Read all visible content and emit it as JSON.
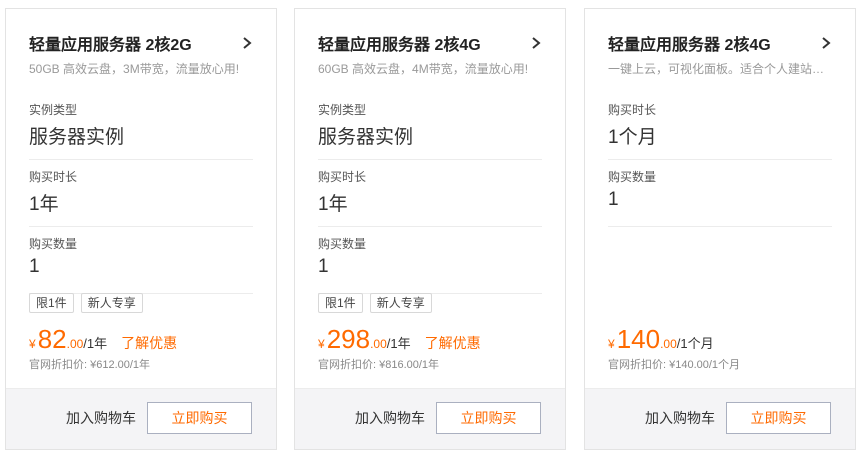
{
  "cards": [
    {
      "title": "轻量应用服务器 2核2G",
      "desc": "50GB 高效云盘，3M带宽，流量放心用!",
      "specs": [
        {
          "label": "实例类型",
          "value": "服务器实例"
        },
        {
          "label": "购买时长",
          "value": "1年"
        },
        {
          "label": "购买数量",
          "value": "1"
        }
      ],
      "tags": [
        "限1件",
        "新人专享"
      ],
      "price": {
        "currency": "¥",
        "integer": "82",
        "decimal": ".00",
        "unit": "/1年",
        "promo": "了解优惠"
      },
      "ref_price": "官网折扣价: ¥612.00/1年",
      "cart_label": "加入购物车",
      "buy_label": "立即购买"
    },
    {
      "title": "轻量应用服务器 2核4G",
      "desc": "60GB 高效云盘，4M带宽，流量放心用!",
      "specs": [
        {
          "label": "实例类型",
          "value": "服务器实例"
        },
        {
          "label": "购买时长",
          "value": "1年"
        },
        {
          "label": "购买数量",
          "value": "1"
        }
      ],
      "tags": [
        "限1件",
        "新人专享"
      ],
      "price": {
        "currency": "¥",
        "integer": "298",
        "decimal": ".00",
        "unit": "/1年",
        "promo": "了解优惠"
      },
      "ref_price": "官网折扣价: ¥816.00/1年",
      "cart_label": "加入购物车",
      "buy_label": "立即购买"
    },
    {
      "title": "轻量应用服务器 2核4G",
      "desc": "一键上云，可视化面板。适合个人建站等...",
      "specs": [
        {
          "label": "购买时长",
          "value": "1个月"
        },
        {
          "label": "购买数量",
          "value": "1"
        }
      ],
      "tags": [],
      "price": {
        "currency": "¥",
        "integer": "140",
        "decimal": ".00",
        "unit": "/1个月",
        "promo": ""
      },
      "ref_price": "官网折扣价: ¥140.00/1个月",
      "cart_label": "加入购物车",
      "buy_label": "立即购买"
    }
  ],
  "colors": {
    "accent": "#ff6a00",
    "footer_bg": "#f4f4f6",
    "border": "#e3e3e3"
  },
  "icons": {
    "title_arrow": "chevron-right-icon"
  }
}
